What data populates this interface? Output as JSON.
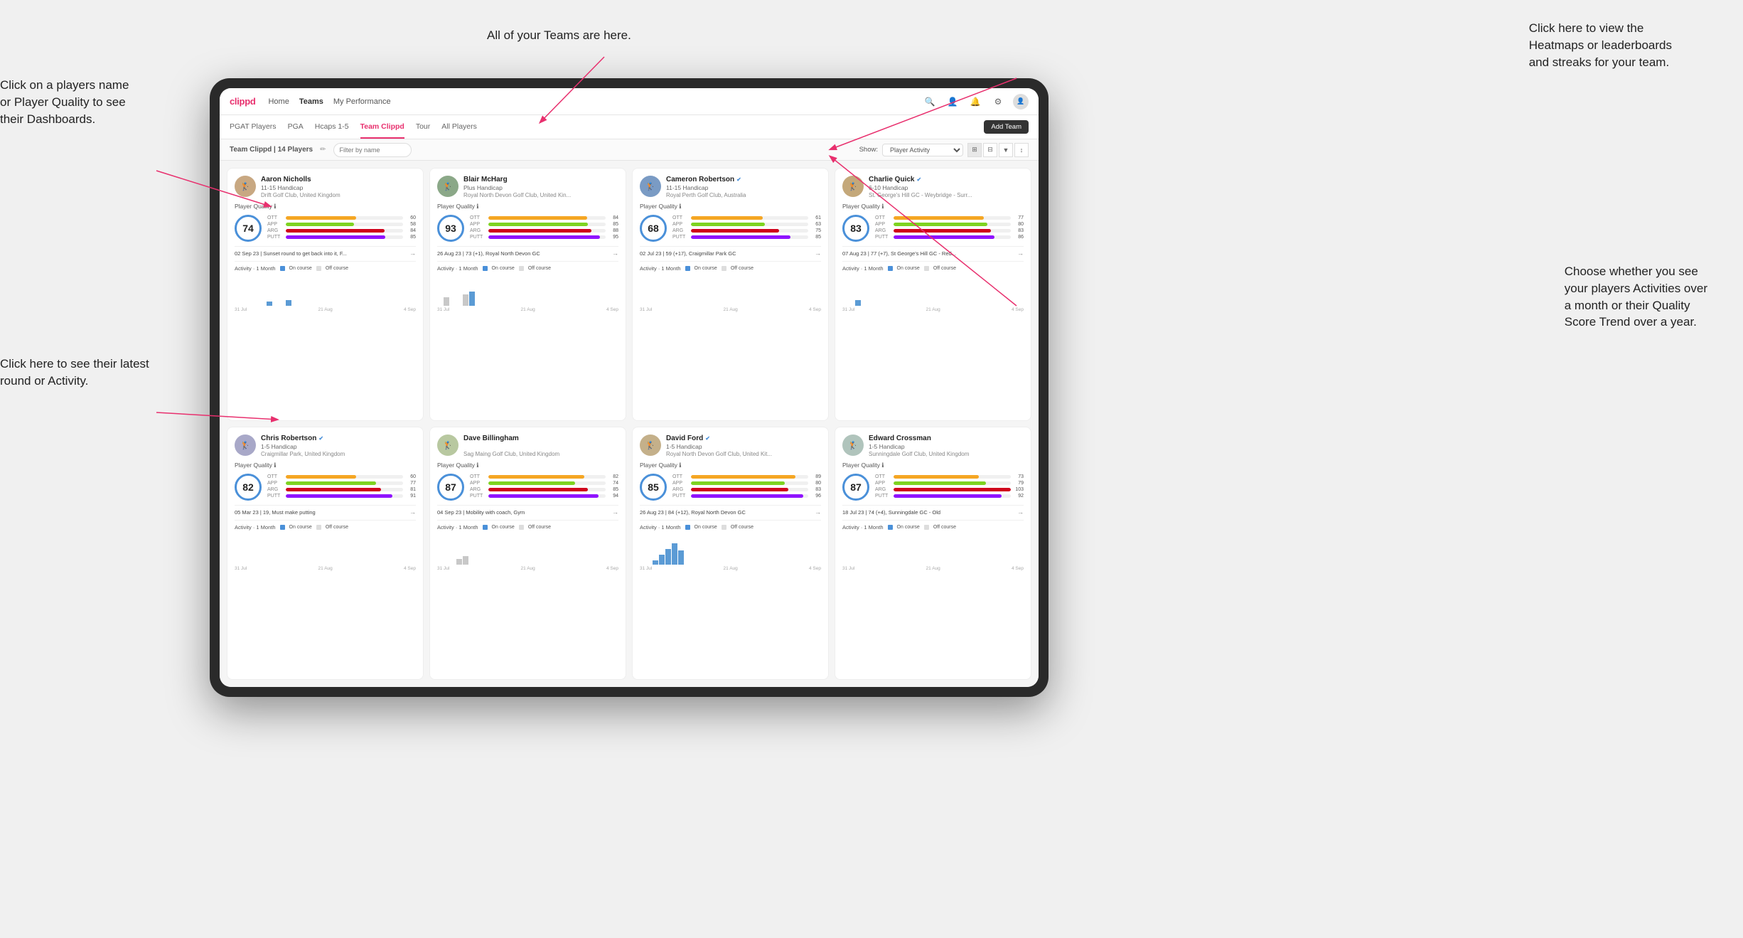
{
  "annotations": {
    "teams_tooltip": "All of your Teams are here.",
    "heatmaps_tooltip": "Click here to view the\nHeatmaps or leaderboards\nand streaks for your team.",
    "players_name_tooltip": "Click on a players name\nor Player Quality to see\ntheir Dashboards.",
    "latest_round_tooltip": "Click here to see their latest\nround or Activity.",
    "activity_tooltip": "Choose whether you see\nyour players Activities over\na month or their Quality\nScore Trend over a year."
  },
  "nav": {
    "logo": "clippd",
    "links": [
      "Home",
      "Teams",
      "My Performance"
    ],
    "icons": [
      "search",
      "person",
      "bell",
      "settings",
      "avatar"
    ]
  },
  "tabs": {
    "items": [
      "PGAT Players",
      "PGA",
      "Hcaps 1-5",
      "Team Clippd",
      "Tour",
      "All Players"
    ],
    "active": "Team Clippd",
    "add_team_label": "Add Team"
  },
  "filter": {
    "team_label": "Team Clippd",
    "players_count": "14 Players",
    "search_placeholder": "Filter by name",
    "show_label": "Show:",
    "dropdown_value": "Player Activity",
    "view_options": [
      "grid-2",
      "grid-3",
      "filter",
      "sort"
    ]
  },
  "players": [
    {
      "name": "Aaron Nicholls",
      "handicap": "11-15 Handicap",
      "club": "Drift Golf Club, United Kingdom",
      "score": 74,
      "ott": 60,
      "app": 58,
      "arg": 84,
      "putt": 85,
      "latest_date": "02 Sep 23",
      "latest_text": "Sunset round to get back into it, F...",
      "avatar_color": "#c8a882",
      "score_color": "#4a90d9"
    },
    {
      "name": "Blair McHarg",
      "handicap": "Plus Handicap",
      "club": "Royal North Devon Golf Club, United Kin...",
      "score": 93,
      "ott": 84,
      "app": 85,
      "arg": 88,
      "putt": 95,
      "latest_date": "26 Aug 23",
      "latest_text": "73 (+1), Royal North Devon GC",
      "avatar_color": "#8ba888",
      "score_color": "#4a90d9",
      "has_bars": true
    },
    {
      "name": "Cameron Robertson",
      "verified": true,
      "handicap": "11-15 Handicap",
      "club": "Royal Perth Golf Club, Australia",
      "score": 68,
      "ott": 61,
      "app": 63,
      "arg": 75,
      "putt": 85,
      "latest_date": "02 Jul 23",
      "latest_text": "59 (+17), Craigmillar Park GC",
      "avatar_color": "#7a9bc4",
      "score_color": "#4a90d9"
    },
    {
      "name": "Charlie Quick",
      "verified": true,
      "handicap": "6-10 Handicap",
      "club": "St. George's Hill GC - Weybridge - Surr...",
      "score": 83,
      "ott": 77,
      "app": 80,
      "arg": 83,
      "putt": 86,
      "latest_date": "07 Aug 23",
      "latest_text": "77 (+7), St George's Hill GC - Red...",
      "avatar_color": "#c4a87a",
      "score_color": "#4a90d9",
      "has_small_bar": true
    },
    {
      "name": "Chris Robertson",
      "verified": true,
      "handicap": "1-5 Handicap",
      "club": "Craigmillar Park, United Kingdom",
      "score": 82,
      "ott": 60,
      "app": 77,
      "arg": 81,
      "putt": 91,
      "latest_date": "05 Mar 23",
      "latest_text": "19, Must make putting",
      "avatar_color": "#a8a8c8",
      "score_color": "#4a90d9"
    },
    {
      "name": "Dave Billingham",
      "handicap": "",
      "club": "Sag Maing Golf Club, United Kingdom",
      "score": 87,
      "ott": 82,
      "app": 74,
      "arg": 85,
      "putt": 94,
      "latest_date": "04 Sep 23",
      "latest_text": "Mobility with coach, Gym",
      "avatar_color": "#b8c8a0",
      "score_color": "#4a90d9"
    },
    {
      "name": "David Ford",
      "verified": true,
      "handicap": "1-5 Handicap",
      "club": "Royal North Devon Golf Club, United Kit...",
      "score": 85,
      "ott": 89,
      "app": 80,
      "arg": 83,
      "putt": 96,
      "latest_date": "26 Aug 23",
      "latest_text": "84 (+12), Royal North Devon GC",
      "avatar_color": "#c4b08a",
      "score_color": "#4a90d9",
      "has_tall_bars": true
    },
    {
      "name": "Edward Crossman",
      "handicap": "1-5 Handicap",
      "club": "Sunningdale Golf Club, United Kingdom",
      "score": 87,
      "ott": 73,
      "app": 79,
      "arg": 103,
      "putt": 92,
      "latest_date": "18 Jul 23",
      "latest_text": "74 (+4), Sunningdale GC - Old",
      "avatar_color": "#b0c4bc",
      "score_color": "#4a90d9"
    }
  ]
}
